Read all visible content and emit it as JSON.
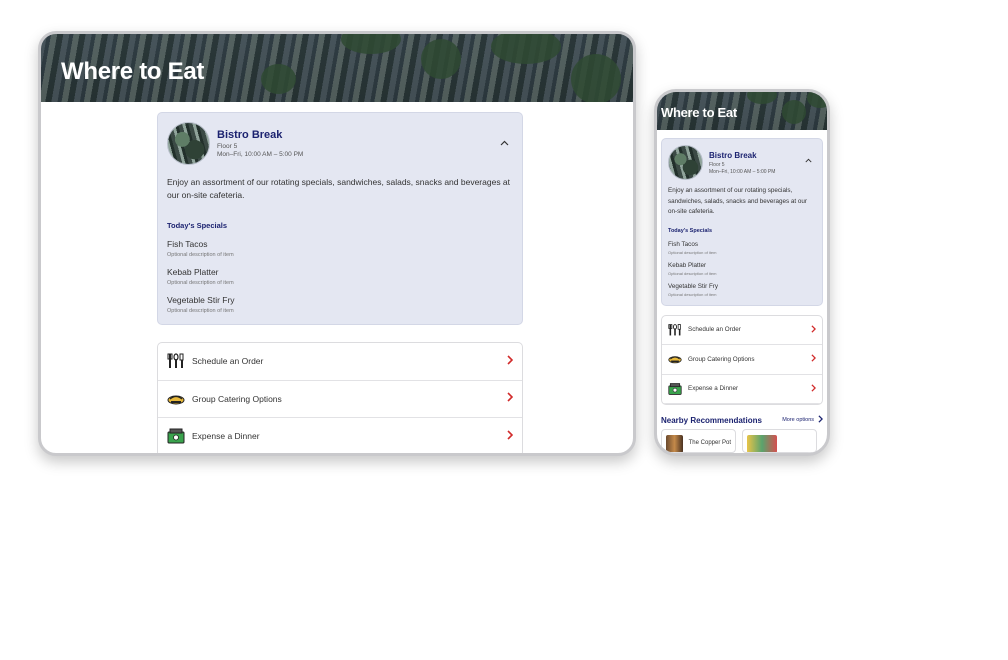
{
  "page": {
    "title": "Where to Eat"
  },
  "restaurant": {
    "name": "Bistro Break",
    "floor": "Floor 5",
    "hours": "Mon–Fri, 10:00 AM – 5:00 PM",
    "description": "Enjoy an assortment of our rotating specials, sandwiches, salads, snacks and beverages at our on-site cafeteria.",
    "specials_heading": "Today's Specials",
    "specials": [
      {
        "name": "Fish Tacos",
        "description": "Optional description of item"
      },
      {
        "name": "Kebab Platter",
        "description": "Optional description of item"
      },
      {
        "name": "Vegetable Stir Fry",
        "description": "Optional description of item"
      }
    ]
  },
  "actions": [
    {
      "label": "Schedule an Order",
      "icon": "utensils-icon"
    },
    {
      "label": "Group Catering Options",
      "icon": "catering-tray-icon"
    },
    {
      "label": "Expense a Dinner",
      "icon": "cash-icon"
    }
  ],
  "nearby": {
    "title": "Nearby Recommendations",
    "more_label": "More options",
    "items": [
      {
        "name": "The Copper Pot"
      },
      {
        "name": ""
      }
    ]
  },
  "colors": {
    "brand_navy": "#1c2370",
    "card_bg": "#e4e7f2",
    "chevron_red": "#d12a2a"
  }
}
